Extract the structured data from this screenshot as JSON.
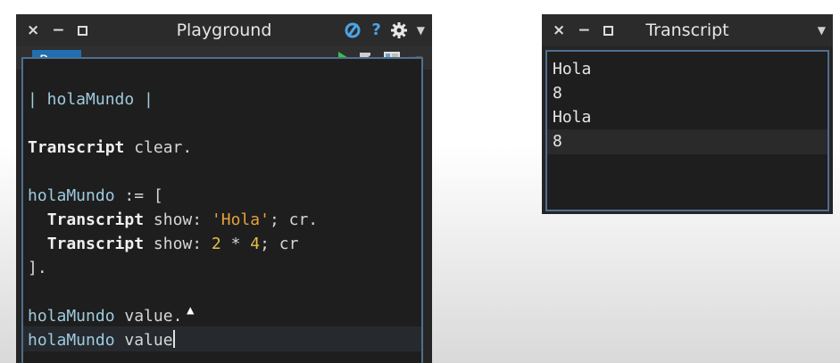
{
  "playground": {
    "title": "Playground",
    "tab_label": "Page",
    "icons": [
      "sync-icon",
      "help-icon",
      "gear-icon",
      "chevron-down-icon",
      "play-icon",
      "export-icon",
      "columns-icon",
      "menu-icon"
    ],
    "code_lines": [
      "| holaMundo |",
      "",
      "Transcript clear.",
      "",
      "holaMundo := [",
      "  Transcript show: 'Hola'; cr.",
      "  Transcript show: 2 * 4; cr",
      "].",
      "",
      "holaMundo value.",
      "holaMundo value"
    ]
  },
  "transcript": {
    "title": "Transcript",
    "lines": [
      "Hola",
      "8",
      "Hola",
      "8"
    ]
  },
  "colors": {
    "titlebar": "#2b2b2b",
    "editor_bg": "#1e1e1e",
    "tab_blue": "#1f6fb2",
    "string_orange": "#e5a13c",
    "run_green": "#3bbf4a"
  }
}
